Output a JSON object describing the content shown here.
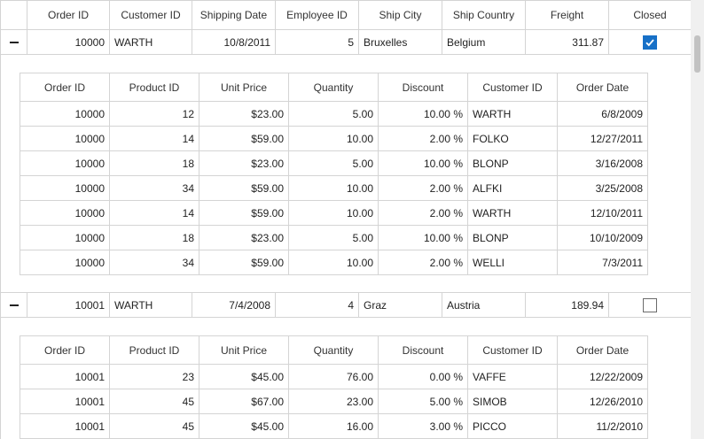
{
  "columns": [
    "Order ID",
    "Customer ID",
    "Shipping Date",
    "Employee ID",
    "Ship City",
    "Ship Country",
    "Freight",
    "Closed"
  ],
  "sub_columns": [
    "Order ID",
    "Product ID",
    "Unit Price",
    "Quantity",
    "Discount",
    "Customer ID",
    "Order Date"
  ],
  "orders": [
    {
      "order_id": "10000",
      "customer_id": "WARTH",
      "shipping_date": "10/8/2011",
      "employee_id": "5",
      "ship_city": "Bruxelles",
      "ship_country": "Belgium",
      "freight": "311.87",
      "closed": true,
      "details": [
        [
          "10000",
          "12",
          "$23.00",
          "5.00",
          "10.00 %",
          "WARTH",
          "6/8/2009"
        ],
        [
          "10000",
          "14",
          "$59.00",
          "10.00",
          "2.00 %",
          "FOLKO",
          "12/27/2011"
        ],
        [
          "10000",
          "18",
          "$23.00",
          "5.00",
          "10.00 %",
          "BLONP",
          "3/16/2008"
        ],
        [
          "10000",
          "34",
          "$59.00",
          "10.00",
          "2.00 %",
          "ALFKI",
          "3/25/2008"
        ],
        [
          "10000",
          "14",
          "$59.00",
          "10.00",
          "2.00 %",
          "WARTH",
          "12/10/2011"
        ],
        [
          "10000",
          "18",
          "$23.00",
          "5.00",
          "10.00 %",
          "BLONP",
          "10/10/2009"
        ],
        [
          "10000",
          "34",
          "$59.00",
          "10.00",
          "2.00 %",
          "WELLI",
          "7/3/2011"
        ]
      ]
    },
    {
      "order_id": "10001",
      "customer_id": "WARTH",
      "shipping_date": "7/4/2008",
      "employee_id": "4",
      "ship_city": "Graz",
      "ship_country": "Austria",
      "freight": "189.94",
      "closed": false,
      "details": [
        [
          "10001",
          "23",
          "$45.00",
          "76.00",
          "0.00 %",
          "VAFFE",
          "12/22/2009"
        ],
        [
          "10001",
          "45",
          "$67.00",
          "23.00",
          "5.00 %",
          "SIMOB",
          "12/26/2010"
        ],
        [
          "10001",
          "45",
          "$45.00",
          "16.00",
          "3.00 %",
          "PICCO",
          "11/2/2010"
        ]
      ]
    }
  ],
  "icons": {
    "expander": "collapse-minus-icon",
    "check": "checkmark-icon"
  },
  "colors": {
    "accent": "#1770c7",
    "border": "#d4d4d4"
  }
}
